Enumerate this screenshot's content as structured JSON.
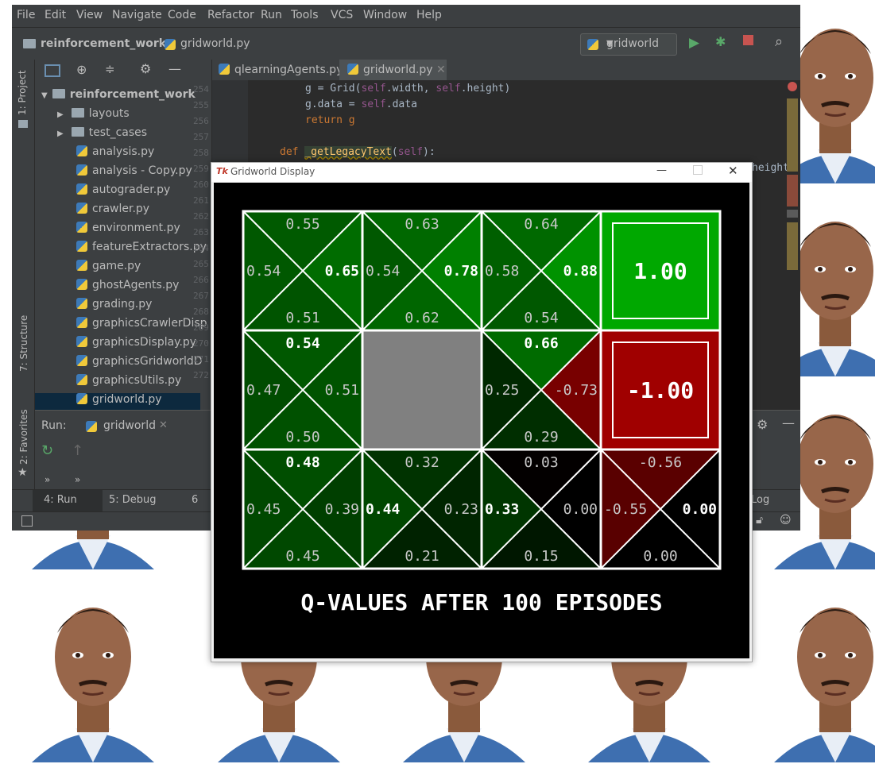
{
  "menu": [
    "File",
    "Edit",
    "View",
    "Navigate",
    "Code",
    "Refactor",
    "Run",
    "Tools",
    "VCS",
    "Window",
    "Help"
  ],
  "breadcrumb": {
    "project": "reinforcement_work",
    "file": "gridworld.py"
  },
  "run_config": "gridworld",
  "left_tools": {
    "project": "1: Project",
    "structure": "7: Structure",
    "favorites": "2: Favorites"
  },
  "tree": {
    "root": "reinforcement_work",
    "folders": [
      "layouts",
      "test_cases"
    ],
    "files": [
      "analysis.py",
      "analysis - Copy.py",
      "autograder.py",
      "crawler.py",
      "environment.py",
      "featureExtractors.py",
      "game.py",
      "ghostAgents.py",
      "grading.py",
      "graphicsCrawlerDisp",
      "graphicsDisplay.py",
      "graphicsGridworldD",
      "graphicsUtils.py",
      "gridworld.py"
    ]
  },
  "tabs": [
    "qlearningAgents.py",
    "gridworld.py"
  ],
  "line_numbers": [
    "254",
    "255",
    "256",
    "257",
    "258",
    "259",
    "260",
    "261",
    "262",
    "263",
    "264",
    "265",
    "266",
    "267",
    "268",
    "269",
    "270",
    "271",
    "272"
  ],
  "code": {
    "l254a": "g = Grid(",
    "l254b": "self",
    ".": ".",
    "l254c": "width, ",
    "l254d": "self",
    "l254e": ".height)",
    "l255a": "g.data = ",
    "l255b": "self",
    "l255c": ".data",
    "l256": "return g",
    "l258a": "def ",
    "l258b": "_getLegacyText",
    "l258c": "(",
    "l258d": "self",
    "l258e": "):",
    "frag": "height"
  },
  "run_panel": {
    "label": "Run:",
    "config": "gridworld",
    "arrows": "»"
  },
  "bottom_tabs": [
    "4: Run",
    "5: Debug",
    "6"
  ],
  "right_fragments": {
    "log": "Log"
  },
  "gw_window": {
    "title": "Gridworld Display",
    "caption": "Q-VALUES AFTER 100 EPISODES"
  },
  "grid": {
    "cells": [
      {
        "r": 0,
        "c": 0,
        "n": "0.55",
        "w": "0.54",
        "e": "0.65",
        "s": "0.51",
        "best": "e",
        "colors": {
          "n": "#005a00",
          "w": "#005800",
          "e": "#006c00",
          "s": "#005400"
        }
      },
      {
        "r": 0,
        "c": 1,
        "n": "0.63",
        "w": "0.54",
        "e": "0.78",
        "s": "0.62",
        "best": "e",
        "colors": {
          "n": "#006800",
          "w": "#005800",
          "e": "#008000",
          "s": "#006600"
        }
      },
      {
        "r": 0,
        "c": 2,
        "n": "0.64",
        "w": "0.58",
        "e": "0.88",
        "s": "0.54",
        "best": "e",
        "colors": {
          "n": "#006900",
          "w": "#005f00",
          "e": "#009200",
          "s": "#005800"
        }
      },
      {
        "r": 0,
        "c": 3,
        "terminal": true,
        "value": "1.00",
        "fill": "#00a800"
      },
      {
        "r": 1,
        "c": 0,
        "n": "0.54",
        "w": "0.47",
        "e": "0.51",
        "s": "0.50",
        "best": "n",
        "colors": {
          "n": "#005800",
          "w": "#004c00",
          "e": "#005300",
          "s": "#005100"
        }
      },
      {
        "r": 1,
        "c": 1,
        "wall": true
      },
      {
        "r": 1,
        "c": 2,
        "n": "0.66",
        "w": "0.25",
        "e": "-0.73",
        "s": "0.29",
        "best": "n",
        "colors": {
          "n": "#006b00",
          "w": "#002800",
          "e": "#780000",
          "s": "#002e00"
        }
      },
      {
        "r": 1,
        "c": 3,
        "terminal": true,
        "value": "-1.00",
        "fill": "#a00000"
      },
      {
        "r": 2,
        "c": 0,
        "n": "0.48",
        "w": "0.45",
        "e": "0.39",
        "s": "0.45",
        "best": "n",
        "colors": {
          "n": "#004e00",
          "w": "#004800",
          "e": "#003f00",
          "s": "#004800"
        }
      },
      {
        "r": 2,
        "c": 1,
        "n": "0.32",
        "w": "0.44",
        "e": "0.23",
        "s": "0.21",
        "best": "w",
        "colors": {
          "n": "#003300",
          "w": "#004700",
          "e": "#002500",
          "s": "#002200"
        }
      },
      {
        "r": 2,
        "c": 2,
        "n": "0.03",
        "w": "0.33",
        "e": "0.00",
        "s": "0.15",
        "best": "w",
        "colors": {
          "n": "#030000",
          "w": "#003500",
          "e": "#000000",
          "s": "#001700"
        }
      },
      {
        "r": 2,
        "c": 3,
        "n": "-0.56",
        "w": "-0.55",
        "e": "0.00",
        "s": "0.00",
        "best": "e",
        "colors": {
          "n": "#5a0000",
          "w": "#590000",
          "e": "#000000",
          "s": "#000000"
        }
      }
    ],
    "wall_color": "#808080"
  }
}
